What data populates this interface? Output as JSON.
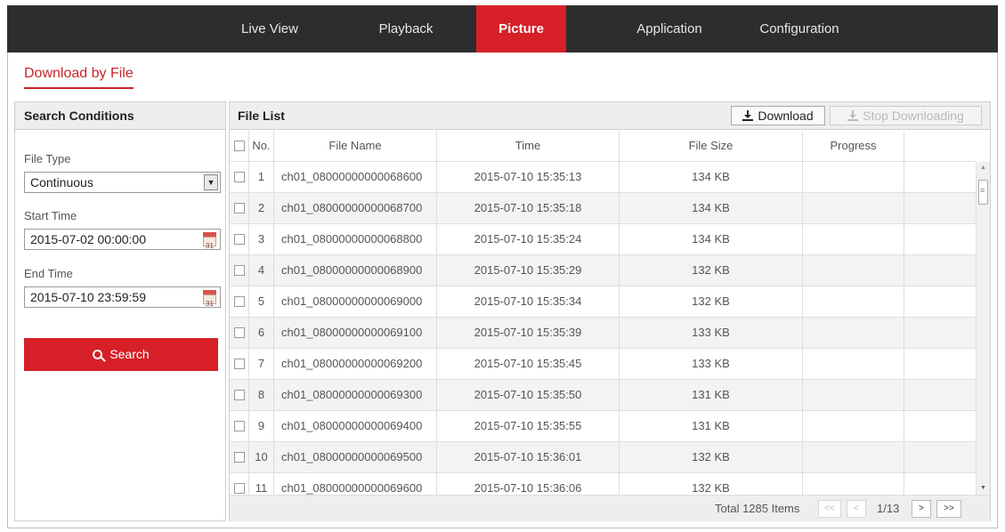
{
  "nav": {
    "items": [
      {
        "label": "Live View"
      },
      {
        "label": "Playback"
      },
      {
        "label": "Picture"
      },
      {
        "label": "Application"
      },
      {
        "label": "Configuration"
      }
    ],
    "active": "Picture"
  },
  "subtab": {
    "label": "Download by File"
  },
  "search_conditions": {
    "title": "Search Conditions",
    "file_type_label": "File Type",
    "file_type_value": "Continuous",
    "start_time_label": "Start Time",
    "start_time_value": "2015-07-02 00:00:00",
    "end_time_label": "End Time",
    "end_time_value": "2015-07-10 23:59:59",
    "search_label": "Search"
  },
  "file_list": {
    "title": "File List",
    "download_label": "Download",
    "stop_label": "Stop Downloading",
    "columns": [
      "No.",
      "File Name",
      "Time",
      "File Size",
      "Progress"
    ],
    "rows": [
      {
        "no": "1",
        "name": "ch01_08000000000068600",
        "time": "2015-07-10 15:35:13",
        "size": "134 KB"
      },
      {
        "no": "2",
        "name": "ch01_08000000000068700",
        "time": "2015-07-10 15:35:18",
        "size": "134 KB"
      },
      {
        "no": "3",
        "name": "ch01_08000000000068800",
        "time": "2015-07-10 15:35:24",
        "size": "134 KB"
      },
      {
        "no": "4",
        "name": "ch01_08000000000068900",
        "time": "2015-07-10 15:35:29",
        "size": "132 KB"
      },
      {
        "no": "5",
        "name": "ch01_08000000000069000",
        "time": "2015-07-10 15:35:34",
        "size": "132 KB"
      },
      {
        "no": "6",
        "name": "ch01_08000000000069100",
        "time": "2015-07-10 15:35:39",
        "size": "133 KB"
      },
      {
        "no": "7",
        "name": "ch01_08000000000069200",
        "time": "2015-07-10 15:35:45",
        "size": "133 KB"
      },
      {
        "no": "8",
        "name": "ch01_08000000000069300",
        "time": "2015-07-10 15:35:50",
        "size": "131 KB"
      },
      {
        "no": "9",
        "name": "ch01_08000000000069400",
        "time": "2015-07-10 15:35:55",
        "size": "131 KB"
      },
      {
        "no": "10",
        "name": "ch01_08000000000069500",
        "time": "2015-07-10 15:36:01",
        "size": "132 KB"
      },
      {
        "no": "11",
        "name": "ch01_08000000000069600",
        "time": "2015-07-10 15:36:06",
        "size": "132 KB"
      }
    ]
  },
  "pager": {
    "total": "Total 1285 Items",
    "first": "<<",
    "prev": "<",
    "page": "1/13",
    "next": ">",
    "last": ">>"
  },
  "colors": {
    "accent": "#d61f26",
    "nav_bg": "#2d2d2d"
  }
}
